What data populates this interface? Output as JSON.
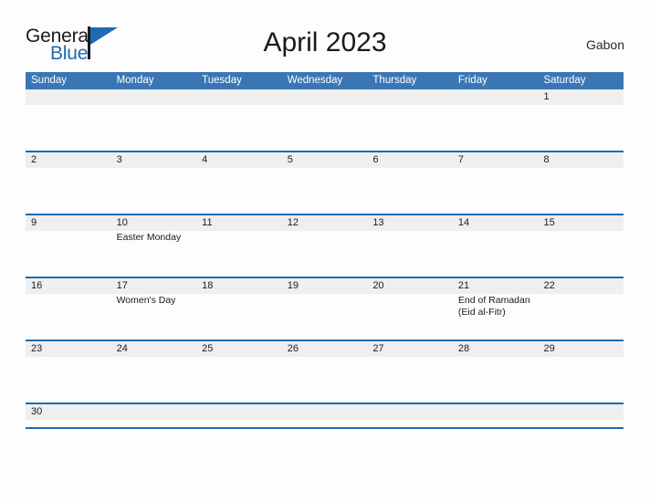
{
  "brand": {
    "name_part1": "General",
    "name_part2": "Blue",
    "mark_icon": "triangle-flag-icon",
    "colors": {
      "primary_blue": "#1f6bb0",
      "header_blue": "#3b76b4",
      "band_gray": "#efefef",
      "text_dark": "#1a1a1a"
    }
  },
  "header": {
    "title": "April 2023",
    "country": "Gabon"
  },
  "calendar": {
    "weekdays": [
      "Sunday",
      "Monday",
      "Tuesday",
      "Wednesday",
      "Thursday",
      "Friday",
      "Saturday"
    ],
    "weeks": [
      {
        "days": [
          {
            "date": "",
            "events": []
          },
          {
            "date": "",
            "events": []
          },
          {
            "date": "",
            "events": []
          },
          {
            "date": "",
            "events": []
          },
          {
            "date": "",
            "events": []
          },
          {
            "date": "",
            "events": []
          },
          {
            "date": "1",
            "events": []
          }
        ]
      },
      {
        "days": [
          {
            "date": "2",
            "events": []
          },
          {
            "date": "3",
            "events": []
          },
          {
            "date": "4",
            "events": []
          },
          {
            "date": "5",
            "events": []
          },
          {
            "date": "6",
            "events": []
          },
          {
            "date": "7",
            "events": []
          },
          {
            "date": "8",
            "events": []
          }
        ]
      },
      {
        "days": [
          {
            "date": "9",
            "events": []
          },
          {
            "date": "10",
            "events": [
              "Easter Monday"
            ]
          },
          {
            "date": "11",
            "events": []
          },
          {
            "date": "12",
            "events": []
          },
          {
            "date": "13",
            "events": []
          },
          {
            "date": "14",
            "events": []
          },
          {
            "date": "15",
            "events": []
          }
        ]
      },
      {
        "days": [
          {
            "date": "16",
            "events": []
          },
          {
            "date": "17",
            "events": [
              "Women's Day"
            ]
          },
          {
            "date": "18",
            "events": []
          },
          {
            "date": "19",
            "events": []
          },
          {
            "date": "20",
            "events": []
          },
          {
            "date": "21",
            "events": [
              "End of Ramadan",
              "(Eid al-Fitr)"
            ]
          },
          {
            "date": "22",
            "events": []
          }
        ]
      },
      {
        "days": [
          {
            "date": "23",
            "events": []
          },
          {
            "date": "24",
            "events": []
          },
          {
            "date": "25",
            "events": []
          },
          {
            "date": "26",
            "events": []
          },
          {
            "date": "27",
            "events": []
          },
          {
            "date": "28",
            "events": []
          },
          {
            "date": "29",
            "events": []
          }
        ]
      },
      {
        "last": true,
        "days": [
          {
            "date": "30",
            "events": []
          },
          {
            "date": "",
            "events": []
          },
          {
            "date": "",
            "events": []
          },
          {
            "date": "",
            "events": []
          },
          {
            "date": "",
            "events": []
          },
          {
            "date": "",
            "events": []
          },
          {
            "date": "",
            "events": []
          }
        ]
      }
    ]
  }
}
